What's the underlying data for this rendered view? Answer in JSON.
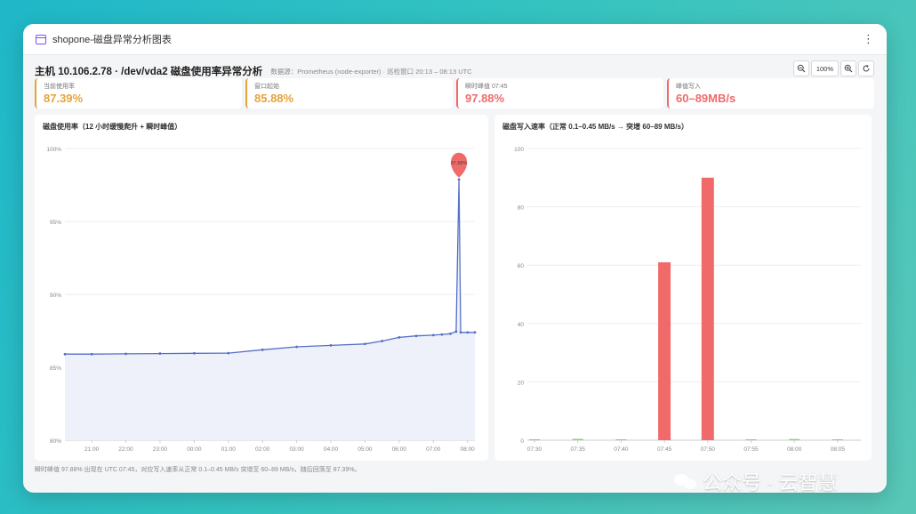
{
  "window": {
    "title": "shopone-磁盘异常分析图表"
  },
  "header": {
    "title": "主机 10.106.2.78 · /dev/vda2 磁盘使用率异常分析",
    "source": "数据源：Prometheus (node-exporter) · 巡检窗口 20:13 – 08:13 UTC"
  },
  "zoom": {
    "level": "100%"
  },
  "stats": [
    {
      "label": "当前使用率",
      "value": "87.39%",
      "color": "#e8a23a"
    },
    {
      "label": "窗口起始",
      "value": "85.88%",
      "color": "#e8a23a"
    },
    {
      "label": "瞬时峰值 07:45",
      "value": "97.88%",
      "color": "#f06a6a"
    },
    {
      "label": "峰值写入",
      "value": "60–89MB/s",
      "color": "#f06a6a"
    }
  ],
  "footnote": "瞬时峰值 97.88% 出现在 UTC 07:45，对应写入速率从正常 0.1–0.45 MB/s 突增至 60–89 MB/s，随后回落至 87.39%。",
  "watermark": {
    "text": "公众号 · 云智慧"
  },
  "chart_data": [
    {
      "type": "area",
      "title": "磁盘使用率（12 小时缓慢爬升 + 瞬时峰值）",
      "xlabel": "",
      "ylabel": "",
      "ylim": [
        80,
        100
      ],
      "yticks": [
        "80%",
        "85%",
        "90%",
        "95%",
        "100%"
      ],
      "ytick_values": [
        80,
        85,
        90,
        95,
        100
      ],
      "xticks": [
        "21:00",
        "22:00",
        "23:00",
        "00:00",
        "01:00",
        "02:00",
        "03:00",
        "04:00",
        "05:00",
        "06:00",
        "07:00",
        "08:00"
      ],
      "x_range_minutes": [
        "20:13",
        "08:13"
      ],
      "points": [
        [
          "20:13",
          85.9
        ],
        [
          "21:00",
          85.9
        ],
        [
          "22:00",
          85.92
        ],
        [
          "23:00",
          85.94
        ],
        [
          "00:00",
          85.96
        ],
        [
          "01:00",
          85.97
        ],
        [
          "02:00",
          86.2
        ],
        [
          "03:00",
          86.4
        ],
        [
          "04:00",
          86.5
        ],
        [
          "05:00",
          86.6
        ],
        [
          "05:30",
          86.8
        ],
        [
          "06:00",
          87.05
        ],
        [
          "06:30",
          87.15
        ],
        [
          "07:00",
          87.2
        ],
        [
          "07:15",
          87.25
        ],
        [
          "07:30",
          87.3
        ],
        [
          "07:40",
          87.45
        ],
        [
          "07:45",
          97.88
        ],
        [
          "07:48",
          87.39
        ],
        [
          "08:00",
          87.39
        ],
        [
          "08:13",
          87.39
        ]
      ],
      "peak": {
        "x": "07:45",
        "y": 97.88,
        "label": "97.88%"
      },
      "line_color": "#5470c6",
      "peak_color": "#f06a6a"
    },
    {
      "type": "bar",
      "title": "磁盘写入速率（正常 0.1–0.45 MB/s → 突增 60–89 MB/s）",
      "ylim": [
        0,
        100
      ],
      "yticks": [
        "0",
        "20",
        "40",
        "60",
        "80",
        "100"
      ],
      "ytick_values": [
        0,
        20,
        40,
        60,
        80,
        100
      ],
      "categories": [
        "07:30",
        "07:35",
        "07:40",
        "07:45",
        "07:50",
        "07:55",
        "08:00",
        "08:05"
      ],
      "values": [
        0.2,
        0.45,
        0.1,
        61,
        90,
        0.15,
        0.4,
        0.1
      ],
      "normal_color": "#91cc75",
      "spike_color": "#f06a6a"
    }
  ]
}
